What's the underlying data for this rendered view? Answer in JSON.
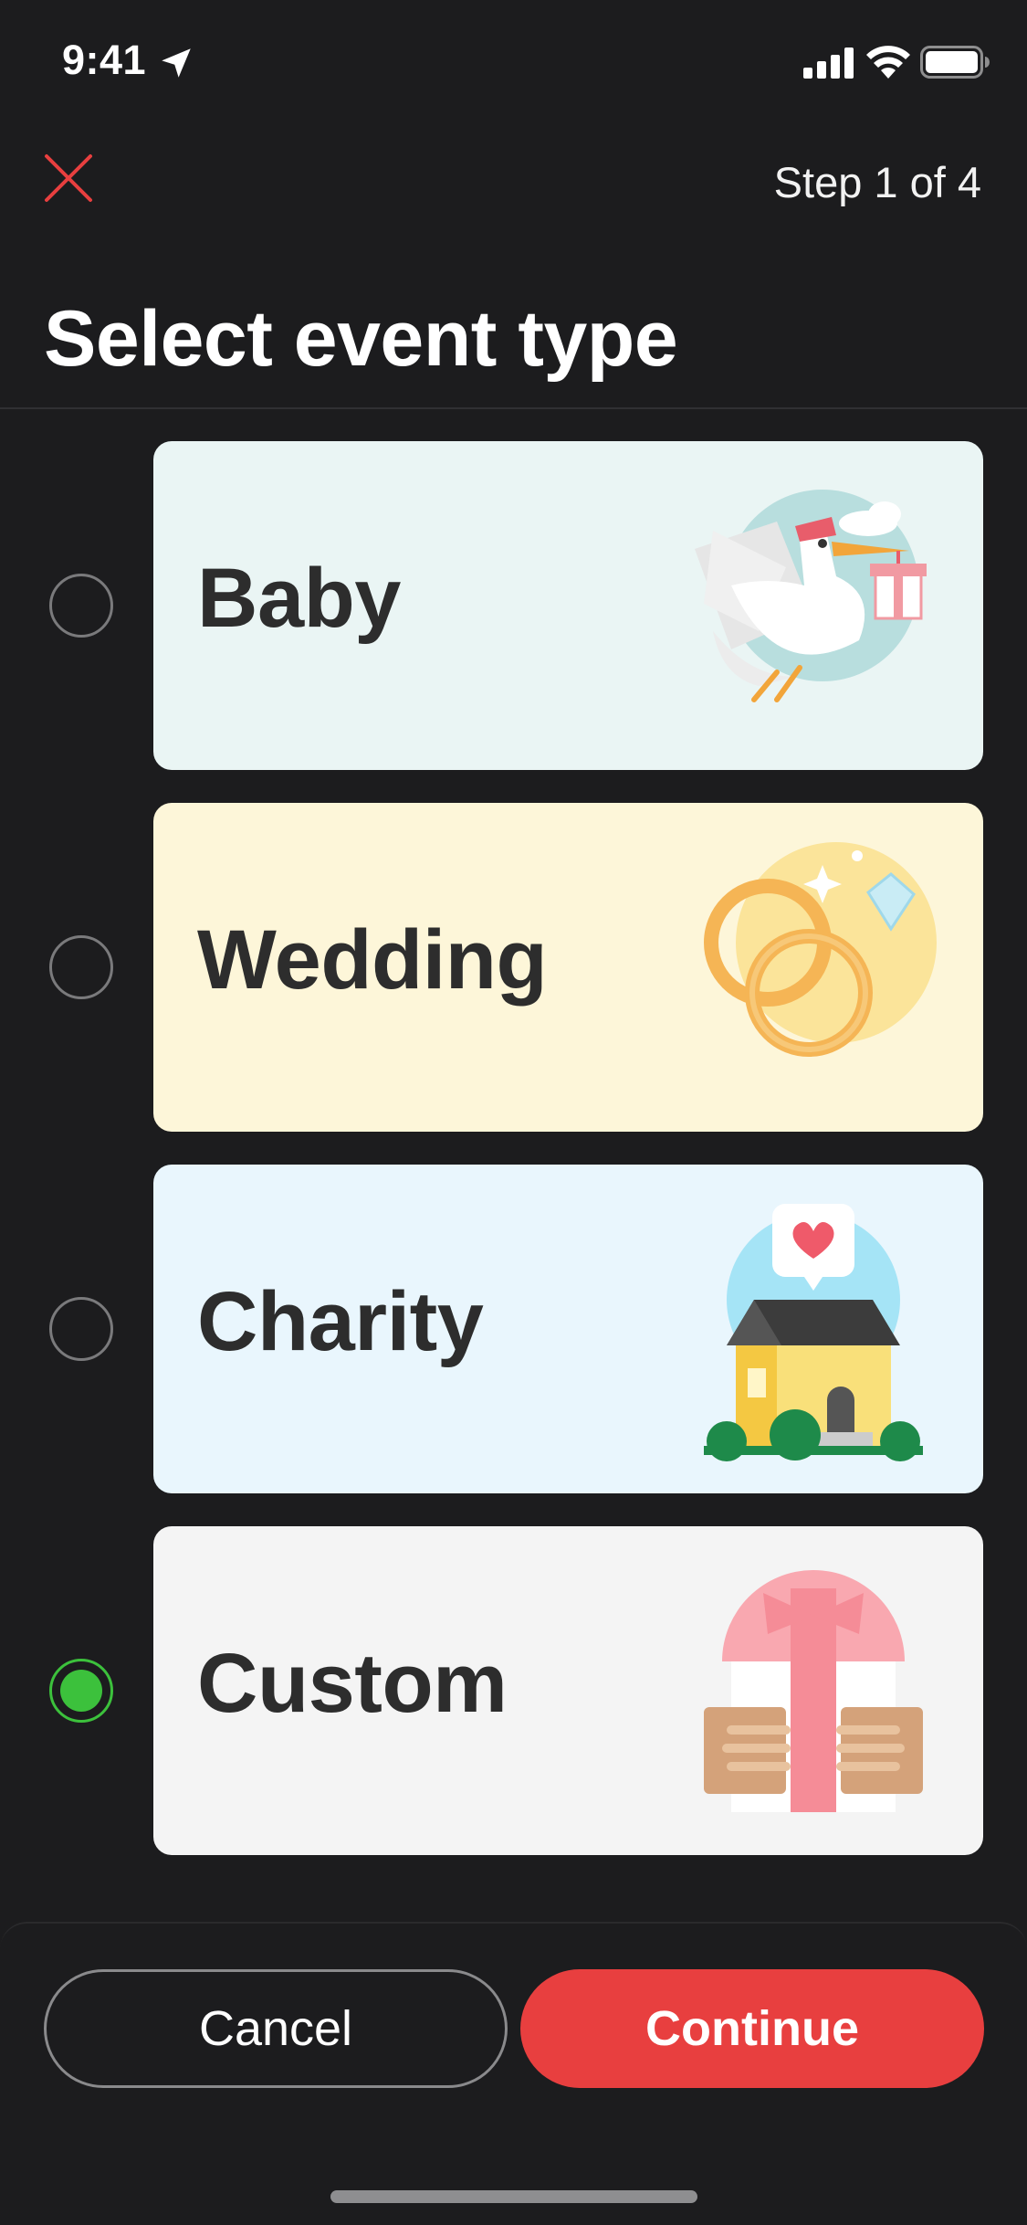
{
  "status_bar": {
    "time": "9:41"
  },
  "header": {
    "step": "Step 1 of 4",
    "title": "Select event type"
  },
  "options": [
    {
      "label": "Baby",
      "selected": false,
      "bg": "#eaf5f4",
      "icon": "stork-icon"
    },
    {
      "label": "Wedding",
      "selected": false,
      "bg": "#fdf6d9",
      "icon": "wedding-rings-icon"
    },
    {
      "label": "Charity",
      "selected": false,
      "bg": "#e9f6fd",
      "icon": "charity-house-icon"
    },
    {
      "label": "Custom",
      "selected": true,
      "bg": "#f4f4f4",
      "icon": "gift-box-icon"
    }
  ],
  "footer": {
    "cancel_label": "Cancel",
    "continue_label": "Continue"
  },
  "colors": {
    "accent": "#e83f3f",
    "selected": "#3cc13c",
    "background": "#1c1c1e"
  }
}
